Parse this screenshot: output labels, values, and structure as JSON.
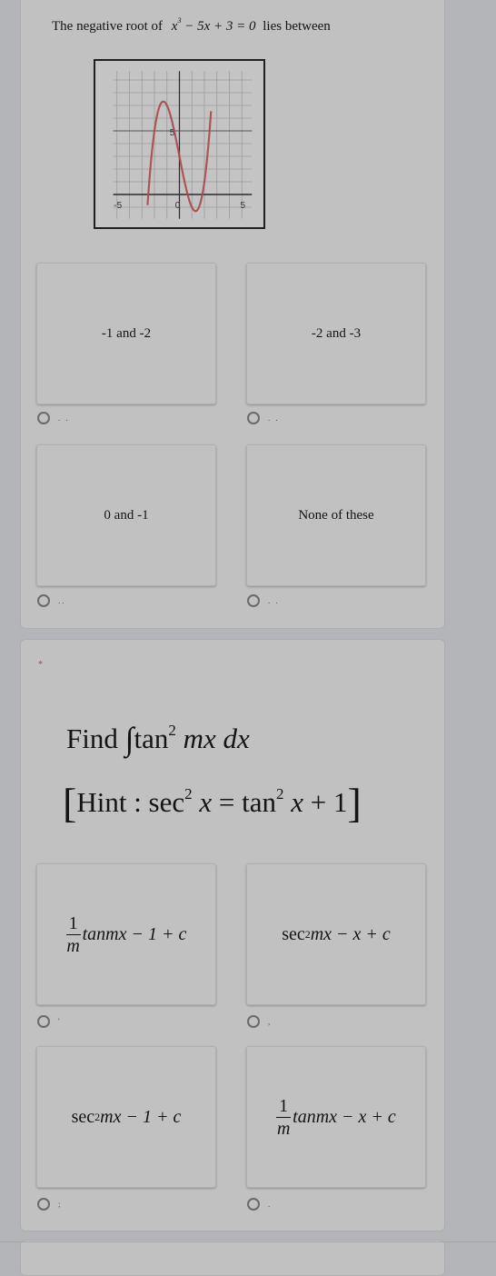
{
  "question1": {
    "text_prefix": "The negative root of",
    "equation": {
      "base": "x",
      "exp": "3",
      "rest": " − 5x + 3 = 0"
    },
    "text_suffix": "lies between",
    "graph": {
      "x_ticks": [
        "-5",
        "0",
        "5"
      ],
      "y_ticks": [
        "5"
      ],
      "xlim": [
        -6,
        6
      ],
      "ylim": [
        -2,
        10
      ],
      "curve_color": "#a94a4a",
      "function": "x^3 - 5x + 3"
    },
    "options": [
      {
        "label": "-1 and -2",
        "radio_label": ". ."
      },
      {
        "label": "-2 and -3",
        "radio_label": ". ."
      },
      {
        "label": "0 and -1",
        "radio_label": ".."
      },
      {
        "label": "None of these",
        "radio_label": ".  ."
      }
    ]
  },
  "question2": {
    "required_mark": "*",
    "find": "Find",
    "integral": "∫",
    "tan": "tan",
    "sq": "2",
    "mx": "mx",
    "dx": "dx",
    "hint": {
      "open": "[",
      "label": "Hint : sec",
      "sq": "2",
      "x": "x",
      "eq": " = tan",
      "sq2": "2",
      "x2": "x",
      "plus": " + 1",
      "close": "]"
    },
    "options": [
      {
        "frac_num": "1",
        "frac_den": "m",
        "tan": "tan",
        "rest": " mx − 1 + c",
        "radio_label": "'"
      },
      {
        "sec": "sec",
        "sq": "2",
        "rest": " mx − x + c",
        "radio_label": ","
      },
      {
        "sec": "sec",
        "sq": "2",
        "rest": " mx − 1 + c",
        "radio_label": ";"
      },
      {
        "frac_num": "1",
        "frac_den": "m",
        "tan": "tan",
        "rest": " mx − x + c",
        "radio_label": "."
      }
    ]
  }
}
